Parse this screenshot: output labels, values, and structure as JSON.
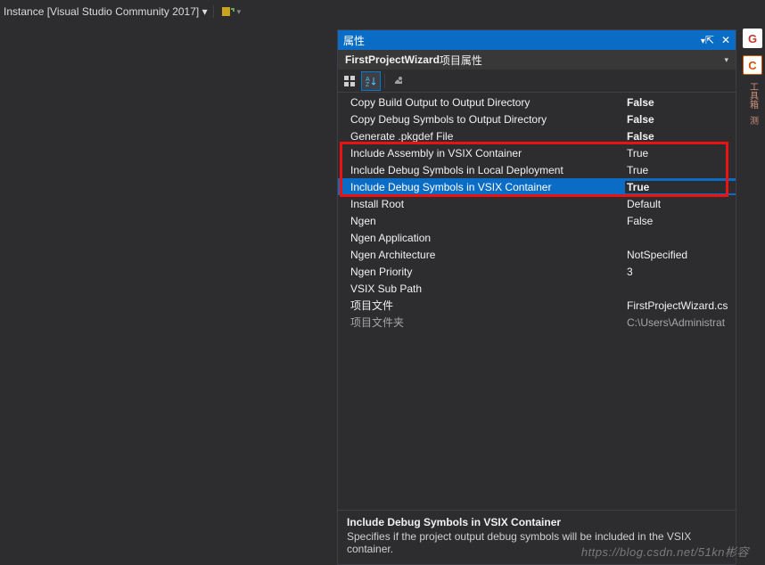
{
  "topbar": {
    "title": "Instance [Visual Studio Community 2017]    ▾"
  },
  "panel": {
    "title": "属性",
    "sub_title_bold": "FirstProjectWizard",
    "sub_title_rest": " 项目属性"
  },
  "toolbar": {
    "categorized": "categorized-icon",
    "alpha": "alpha-sort-icon",
    "events": "wrench-icon"
  },
  "rows": [
    {
      "name": "Copy Build Output to Output Directory",
      "val": "False",
      "bold": true,
      "sel": false
    },
    {
      "name": "Copy Debug Symbols to Output Directory",
      "val": "False",
      "bold": true,
      "sel": false
    },
    {
      "name": "Generate .pkgdef File",
      "val": "False",
      "bold": true,
      "sel": false
    },
    {
      "name": "Include Assembly in VSIX Container",
      "val": "True",
      "bold": false,
      "sel": false
    },
    {
      "name": "Include Debug Symbols in Local Deployment",
      "val": "True",
      "bold": false,
      "sel": false
    },
    {
      "name": "Include Debug Symbols in VSIX Container",
      "val": "True",
      "bold": true,
      "sel": true
    },
    {
      "name": "Install Root",
      "val": "Default",
      "bold": false,
      "sel": false
    },
    {
      "name": "Ngen",
      "val": "False",
      "bold": false,
      "sel": false
    },
    {
      "name": "Ngen Application",
      "val": "",
      "bold": false,
      "sel": false
    },
    {
      "name": "Ngen Architecture",
      "val": "NotSpecified",
      "bold": false,
      "sel": false
    },
    {
      "name": "Ngen Priority",
      "val": "3",
      "bold": false,
      "sel": false
    },
    {
      "name": "VSIX Sub Path",
      "val": "",
      "bold": false,
      "sel": false
    },
    {
      "name": "项目文件",
      "val": "FirstProjectWizard.cs",
      "bold": false,
      "sel": false,
      "dim": false
    },
    {
      "name": "项目文件夹",
      "val": "C:\\Users\\Administrat",
      "bold": false,
      "sel": false,
      "dim": true
    }
  ],
  "help": {
    "title": "Include Debug Symbols in VSIX Container",
    "desc": "Specifies if the project output debug symbols will be included in the VSIX container."
  },
  "watermark": "https://blog.csdn.net/51kn彬容",
  "right": {
    "tileG": "G",
    "tileC": "C",
    "label1": "工具箱",
    "label2": "测"
  }
}
